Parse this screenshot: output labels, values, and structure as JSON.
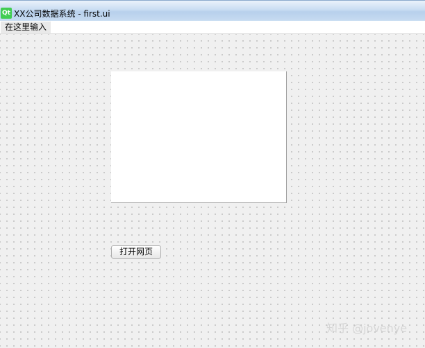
{
  "window": {
    "app_icon_text": "Qt",
    "title": "XX公司数据系统 - first.ui"
  },
  "menubar": {
    "placeholder_item": "在这里输入"
  },
  "form": {
    "open_page_button": "打开网页"
  },
  "watermark": {
    "text": "知乎 @jovenye"
  },
  "colors": {
    "qt_logo": "#41cd52",
    "canvas_background": "#f0f0f0",
    "webview_background": "#ffffff"
  }
}
